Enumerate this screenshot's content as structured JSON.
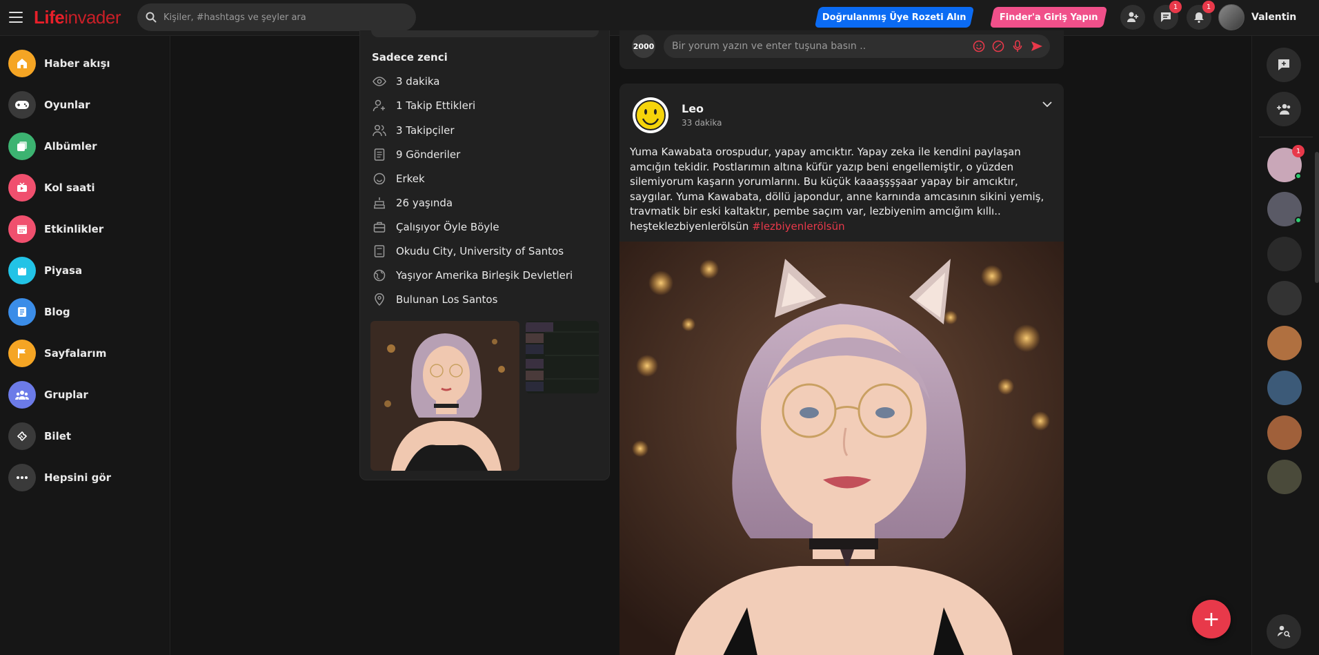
{
  "header": {
    "logo_life": "Life",
    "logo_invader": "invader",
    "search_placeholder": "Kişiler, #hashtags ve şeyler ara",
    "verified_badge_button": "Doğrulanmış Üye Rozeti Alın",
    "finder_login_button": "Finder'a Giriş Yapın",
    "messages_badge": "1",
    "notifications_badge": "1",
    "user_name": "Valentin"
  },
  "sidebar": {
    "items": [
      {
        "label": "Haber akışı",
        "icon": "home-icon",
        "color": "#f5a524"
      },
      {
        "label": "Oyunlar",
        "icon": "gamepad-icon",
        "color": "#3a3a3a"
      },
      {
        "label": "Albümler",
        "icon": "albums-icon",
        "color": "#3cb371"
      },
      {
        "label": "Kol saati",
        "icon": "watch-video-icon",
        "color": "#f0506e"
      },
      {
        "label": "Etkinlikler",
        "icon": "calendar-icon",
        "color": "#f0506e"
      },
      {
        "label": "Piyasa",
        "icon": "shopping-bag-icon",
        "color": "#22c3e6"
      },
      {
        "label": "Blog",
        "icon": "blog-icon",
        "color": "#3b8de8"
      },
      {
        "label": "Sayfalarım",
        "icon": "flag-icon",
        "color": "#f5a524"
      },
      {
        "label": "Gruplar",
        "icon": "groups-icon",
        "color": "#6c7be8"
      },
      {
        "label": "Bilet",
        "icon": "ticket-icon",
        "color": "#3a3a3a"
      },
      {
        "label": "Hepsini gör",
        "icon": "more-icon",
        "color": "#3a3a3a"
      }
    ]
  },
  "profile": {
    "bio": "Sadece zenci",
    "info": [
      {
        "icon": "eye-icon",
        "text": "3 dakika"
      },
      {
        "icon": "user-plus-icon",
        "text": "1 Takip Ettikleri"
      },
      {
        "icon": "users-icon",
        "text": "3 Takipçiler"
      },
      {
        "icon": "document-icon",
        "text": "9 Gönderiler"
      },
      {
        "icon": "smile-icon",
        "text": "Erkek"
      },
      {
        "icon": "cake-icon",
        "text": "26 yaşında"
      },
      {
        "icon": "briefcase-icon",
        "text": "Çalışıyor Öyle Böyle"
      },
      {
        "icon": "book-icon",
        "text": "Okudu City, University of Santos"
      },
      {
        "icon": "globe-icon",
        "text": "Yaşıyor Amerika Birleşik Devletleri"
      },
      {
        "icon": "location-pin-icon",
        "text": "Bulunan Los Santos"
      }
    ]
  },
  "comment": {
    "avatar_text": "2000",
    "placeholder": "Bir yorum yazın ve enter tuşuna basın .."
  },
  "post": {
    "author": "Leo",
    "time": "33 dakika",
    "text": "Yuma Kawabata orospudur, yapay amcıktır. Yapay zeka ile kendini paylaşan amcığın tekidir. Postlarımın altına küfür yazıp beni engellemiştir, o yüzden silemiyorum kaşarın yorumlarını. Bu küçük kaaaşşşşaar yapay bir amcıktır, saygılar. Yuma Kawabata, döllü japondur, anne karnında amcasının sikini yemiş, travmatik bir eski kaltaktır, pembe saçım var, lezbiyenim amcığım kıllı.. heşteklezbiyenlerölsün ",
    "hashtag": "#lezbiyenlerölsün"
  },
  "rightrail": {
    "contacts": [
      {
        "badge": "1",
        "online": true,
        "color": "#c9a7b8"
      },
      {
        "online": true,
        "color": "#5a5a66"
      },
      {
        "online": false,
        "color": "#2a2a2a"
      },
      {
        "online": false,
        "color": "#333333"
      },
      {
        "online": false,
        "color": "#b07040"
      },
      {
        "online": false,
        "color": "#3c5a78"
      },
      {
        "online": false,
        "color": "#a0603a"
      },
      {
        "online": false,
        "color": "#4a4a3a"
      }
    ]
  },
  "colors": {
    "accent": "#e8394a",
    "blue": "#0b6bf3",
    "pink": "#f0508a",
    "card": "#212121",
    "bg": "#141414"
  }
}
